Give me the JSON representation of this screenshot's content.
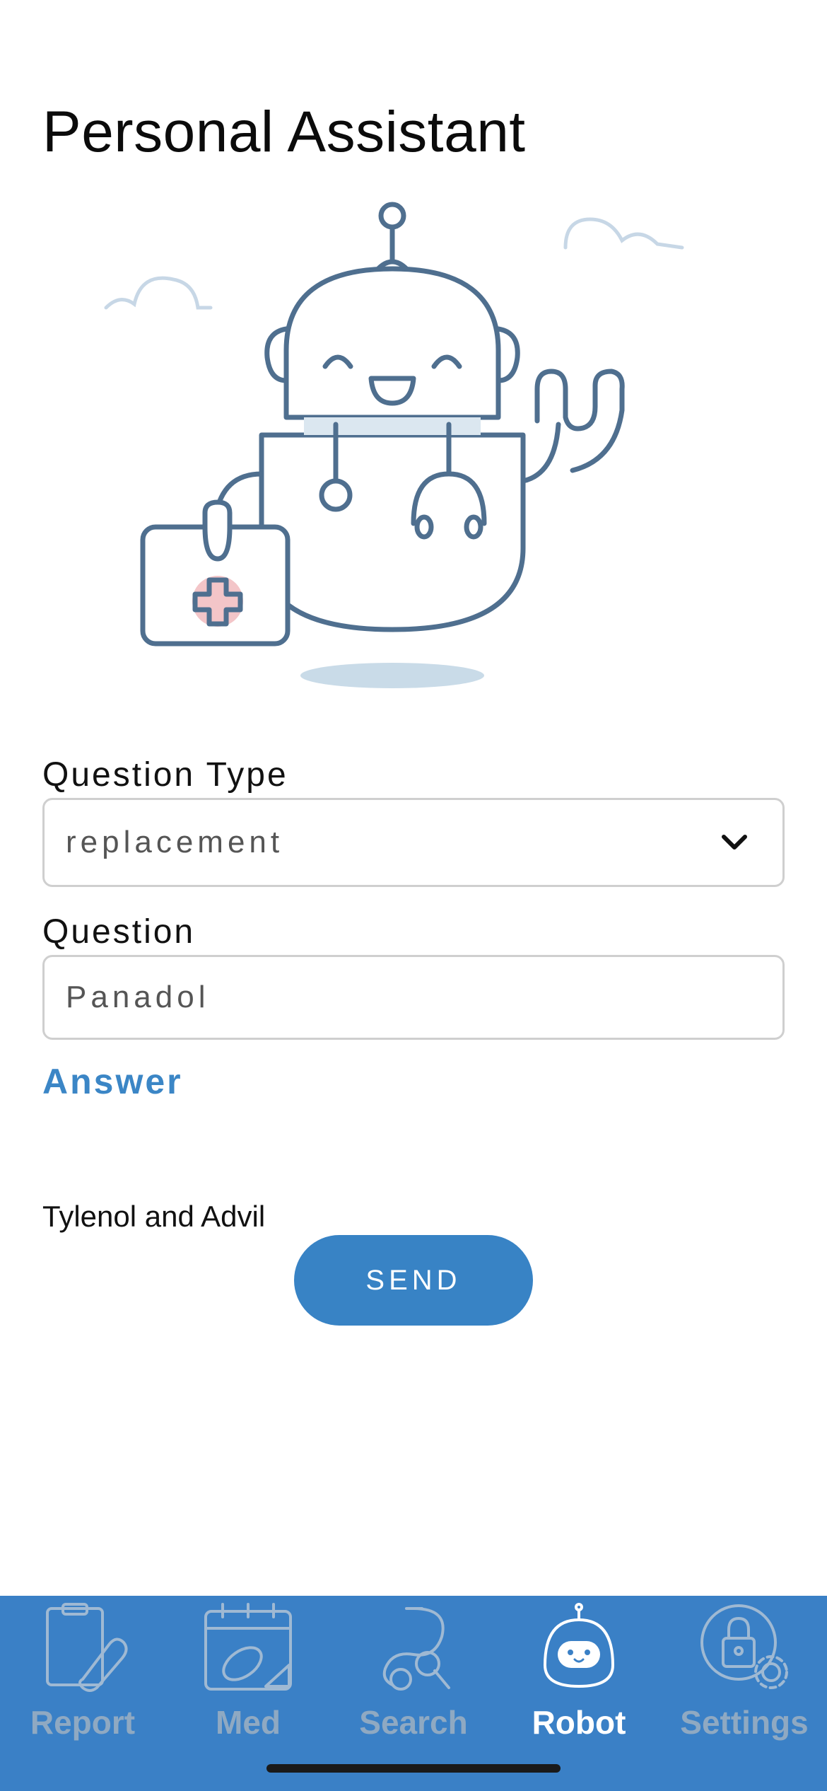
{
  "header": {
    "title": "Personal Assistant"
  },
  "form": {
    "question_type_label": "Question Type",
    "question_type_value": "replacement",
    "question_label": "Question",
    "question_value": "Panadol",
    "answer_label": "Answer",
    "answer_text": "Tylenol and Advil",
    "send_label": "SEND"
  },
  "tabs": [
    {
      "label": "Report",
      "icon": "clipboard-pill-icon",
      "active": false
    },
    {
      "label": "Med",
      "icon": "calendar-pill-icon",
      "active": false
    },
    {
      "label": "Search",
      "icon": "stethoscope-icon",
      "active": false
    },
    {
      "label": "Robot",
      "icon": "robot-icon",
      "active": true
    },
    {
      "label": "Settings",
      "icon": "lock-gear-icon",
      "active": false
    }
  ],
  "colors": {
    "accent": "#3883c5",
    "tabbar": "#3a80c6",
    "inactive_tab": "#8fa9c2",
    "robot_stroke": "#4f6f8f"
  }
}
